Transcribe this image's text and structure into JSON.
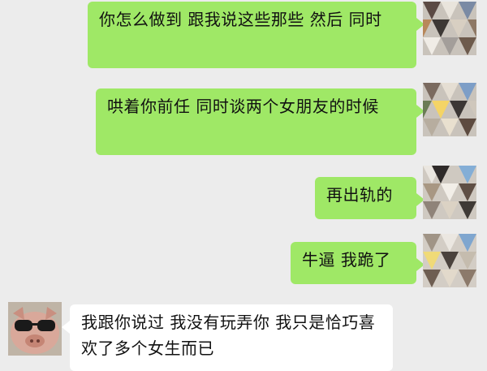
{
  "messages": [
    {
      "side": "right",
      "text": "你怎么做到 跟我说这些那些 然后 同时"
    },
    {
      "side": "right",
      "text": "哄着你前任 同时谈两个女朋友的时候"
    },
    {
      "side": "right",
      "text": "再出轨的"
    },
    {
      "side": "right",
      "text": "牛逼 我跪了"
    },
    {
      "side": "left",
      "text": "我跟你说过 我没有玩弄你 我只是恰巧喜欢了多个女生而已"
    }
  ],
  "avatars": {
    "self": {
      "icon": "geometric-triangles-avatar"
    },
    "contact": {
      "icon": "pig-with-sunglasses-avatar"
    }
  },
  "colors": {
    "background": "#ececec",
    "sent_bubble": "#9fe866",
    "received_bubble": "#ffffff"
  }
}
